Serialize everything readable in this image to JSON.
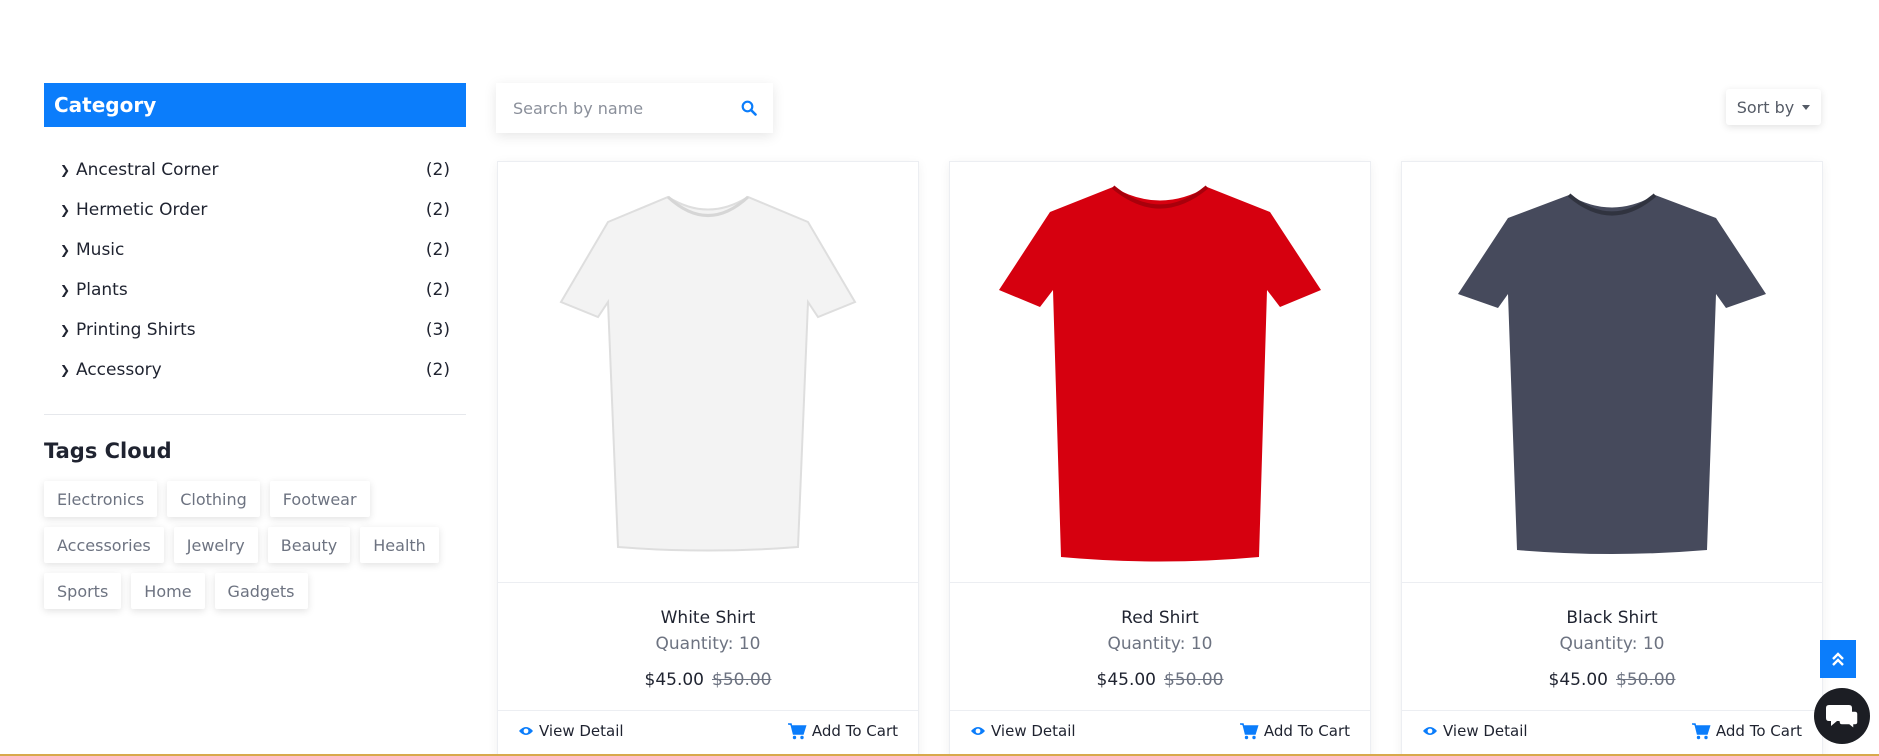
{
  "sidebar": {
    "category_title": "Category",
    "categories": [
      {
        "label": "Ancestral Corner",
        "count": "(2)"
      },
      {
        "label": "Hermetic Order",
        "count": "(2)"
      },
      {
        "label": "Music",
        "count": "(2)"
      },
      {
        "label": "Plants",
        "count": "(2)"
      },
      {
        "label": "Printing Shirts",
        "count": "(3)"
      },
      {
        "label": "Accessory",
        "count": "(2)"
      }
    ],
    "tags_title": "Tags Cloud",
    "tags": [
      "Electronics",
      "Clothing",
      "Footwear",
      "Accessories",
      "Jewelry",
      "Beauty",
      "Health",
      "Sports",
      "Home",
      "Gadgets"
    ]
  },
  "search": {
    "placeholder": "Search by name",
    "icon": "search-icon"
  },
  "sort": {
    "label": "Sort by"
  },
  "products": [
    {
      "name": "White Shirt",
      "quantity": "Quantity: 10",
      "price": "$45.00",
      "old_price": "$50.00",
      "color": "#f2f2f2",
      "view_label": "View Detail",
      "cart_label": "Add To Cart"
    },
    {
      "name": "Red Shirt",
      "quantity": "Quantity: 10",
      "price": "$45.00",
      "old_price": "$50.00",
      "color": "#d6000f",
      "view_label": "View Detail",
      "cart_label": "Add To Cart"
    },
    {
      "name": "Black Shirt",
      "quantity": "Quantity: 10",
      "price": "$45.00",
      "old_price": "$50.00",
      "color": "#464a5c",
      "view_label": "View Detail",
      "cart_label": "Add To Cart"
    }
  ],
  "colors": {
    "accent": "#0b7dfb",
    "text": "#1f2330",
    "muted": "#6d7381"
  }
}
